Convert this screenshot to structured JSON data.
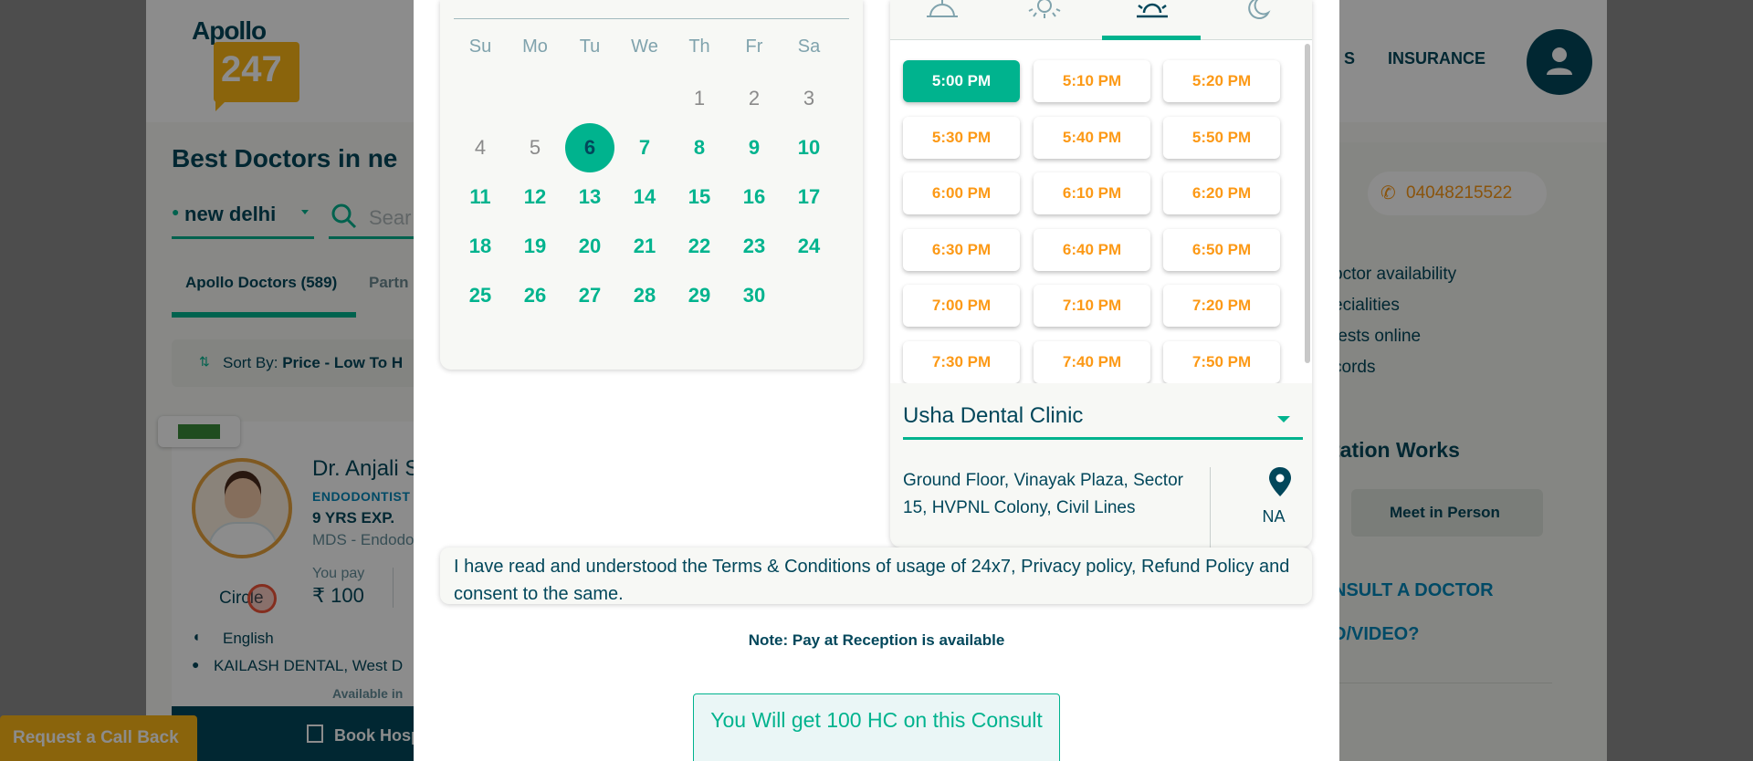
{
  "header": {
    "logo_word": "Apollo",
    "logo_badge": "247",
    "nav_partial": "S",
    "nav_insurance": "INSURANCE"
  },
  "listing": {
    "title": "Best Doctors in ne",
    "location": "new delhi",
    "search_placeholder": "Sear",
    "tab_apollo": "Apollo Doctors (589)",
    "tab_partner": "Partn",
    "sort_label": "Sort By: ",
    "sort_value": "Price - Low To H"
  },
  "doctor": {
    "name": "Dr. Anjali S",
    "specialty": "ENDODONTIST",
    "experience": "9 YRS EXP.",
    "degree": "MDS - Endodo",
    "circle_label": "Circle",
    "you_pay_label": "You pay",
    "price": "₹ 100",
    "language": "English",
    "address": "KAILASH DENTAL, West D",
    "availability": "Available in",
    "book_label": "Book Hosp"
  },
  "callback_label": "Request a Call Back",
  "right_panel": {
    "phone": "04048215522",
    "lines": [
      "octor availability",
      "ecialities",
      " tests online",
      "cords"
    ],
    "works_title": "tation Works",
    "meet_label": "Meet in Person",
    "consult_line1": "NSULT A DOCTOR",
    "consult_line2": "D/VIDEO?"
  },
  "calendar": {
    "weekdays": [
      "Su",
      "Mo",
      "Tu",
      "We",
      "Th",
      "Fr",
      "Sa"
    ],
    "days": [
      "1",
      "2",
      "3",
      "4",
      "5",
      "6",
      "7",
      "8",
      "9",
      "10",
      "11",
      "12",
      "13",
      "14",
      "15",
      "16",
      "17",
      "18",
      "19",
      "20",
      "21",
      "22",
      "23",
      "24",
      "25",
      "26",
      "27",
      "28",
      "29",
      "30"
    ],
    "first_weekday_index": 4,
    "selected_day": "6",
    "past_days": [
      "1",
      "2",
      "3",
      "4",
      "5"
    ]
  },
  "time_of_day_tabs": [
    {
      "name": "morning",
      "active": false
    },
    {
      "name": "afternoon",
      "active": false
    },
    {
      "name": "evening",
      "active": true
    },
    {
      "name": "night",
      "active": false
    }
  ],
  "slots": [
    "5:00 PM",
    "5:10 PM",
    "5:20 PM",
    "5:30 PM",
    "5:40 PM",
    "5:50 PM",
    "6:00 PM",
    "6:10 PM",
    "6:20 PM",
    "6:30 PM",
    "6:40 PM",
    "6:50 PM",
    "7:00 PM",
    "7:10 PM",
    "7:20 PM",
    "7:30 PM",
    "7:40 PM",
    "7:50 PM"
  ],
  "selected_slot": "5:00 PM",
  "clinic": {
    "name": "Usha Dental Clinic",
    "address": "Ground Floor, Vinayak Plaza, Sector 15, HVPNL Colony, Civil Lines",
    "distance": "NA"
  },
  "terms_text": "I have read and understood the Terms & Conditions of usage of 24x7, Privacy policy, Refund Policy and consent to the same.",
  "note_text": "Note: Pay at Reception is available",
  "hc_text": "You Will get 100 HC on this Consult",
  "colors": {
    "teal": "#00b38e",
    "navy": "#02475b",
    "orange": "#fc9916",
    "yellow": "#fcb716"
  }
}
